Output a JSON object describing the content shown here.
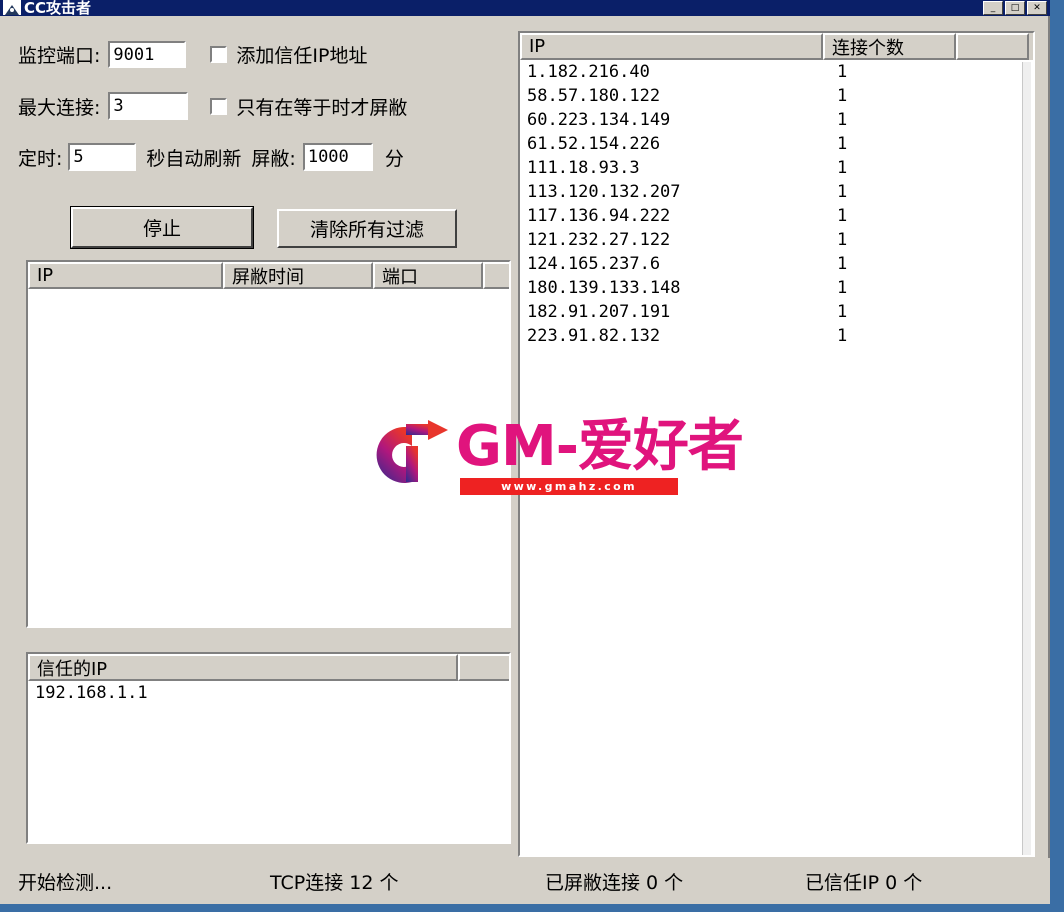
{
  "window": {
    "title": "CC攻击者",
    "icon": "shield-icon",
    "buttons": [
      {
        "name": "minimize-button",
        "glyph": "_"
      },
      {
        "name": "maximize-button",
        "glyph": "□"
      },
      {
        "name": "close-button",
        "glyph": "✕"
      }
    ],
    "frame_color": "#3a6ea5",
    "face_color": "#d4d0c8",
    "titlebar_color": "#0a1f68"
  },
  "controls": {
    "port": {
      "label": "监控端口:",
      "value": "9001"
    },
    "max_conn": {
      "label": "最大连接:",
      "value": "3"
    },
    "timer": {
      "label": "定时:",
      "value": "5",
      "suffix": "秒自动刷新"
    },
    "block_time": {
      "label": "屏敝:",
      "value": "1000",
      "suffix": "分"
    },
    "checkbox_trusted": {
      "label": "添加信任IP地址",
      "checked": false
    },
    "checkbox_equal_only": {
      "label": "只有在等于时才屏敝",
      "checked": false
    },
    "button_stop": "停止",
    "button_clear": "清除所有过滤"
  },
  "connections_list": {
    "headers": [
      "IP",
      "连接个数",
      ""
    ],
    "rows": [
      [
        "1.182.216.40",
        "1"
      ],
      [
        "58.57.180.122",
        "1"
      ],
      [
        "60.223.134.149",
        "1"
      ],
      [
        "61.52.154.226",
        "1"
      ],
      [
        "111.18.93.3",
        "1"
      ],
      [
        "113.120.132.207",
        "1"
      ],
      [
        "117.136.94.222",
        "1"
      ],
      [
        "121.232.27.122",
        "1"
      ],
      [
        "124.165.237.6",
        "1"
      ],
      [
        "180.139.133.148",
        "1"
      ],
      [
        "182.91.207.191",
        "1"
      ],
      [
        "223.91.82.132",
        "1"
      ]
    ]
  },
  "blocked_list": {
    "headers": [
      "IP",
      "屏敝时间",
      "端口",
      ""
    ],
    "rows": []
  },
  "trusted_list": {
    "headers": [
      "信任的IP",
      ""
    ],
    "rows": [
      [
        "192.168.1.1"
      ]
    ]
  },
  "statusbar": {
    "detect": "开始检测...",
    "tcp": "TCP连接 12 个",
    "blocked": "已屏敝连接 0 个",
    "trusted": "已信任IP 0 个"
  },
  "watermark": {
    "logo_letter": "G",
    "brand": "GM-爱好者",
    "url": "www.gmahz.com",
    "brand_color": "#e0147d",
    "url_bg": "#ee2222"
  }
}
